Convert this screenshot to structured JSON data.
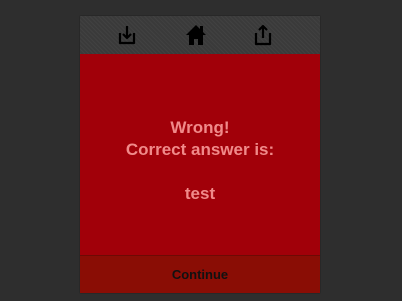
{
  "toolbar": {
    "icons": [
      "download-icon",
      "home-icon",
      "share-icon"
    ]
  },
  "result": {
    "heading": "Wrong!",
    "subheading": "Correct answer is:",
    "answer": "test"
  },
  "footer": {
    "continue_label": "Continue"
  },
  "colors": {
    "background": "#2e2e2e",
    "toolbar": "#3a3a3a",
    "panel": "#a10009",
    "text_accent": "#f08a8a",
    "continue_bar": "#8a0d05"
  }
}
